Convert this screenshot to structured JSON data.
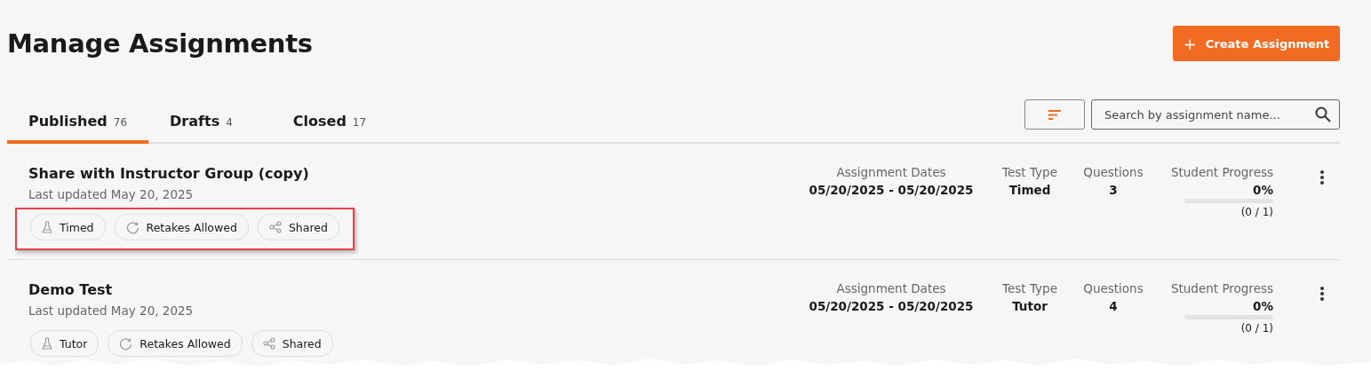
{
  "title": "Manage Assignments",
  "create_button": {
    "label": "Create Assignment",
    "icon": "+"
  },
  "tabs": [
    {
      "label": "Published",
      "count": "76",
      "selected": true
    },
    {
      "label": "Drafts",
      "count": "4",
      "selected": false
    },
    {
      "label": "Closed",
      "count": "17",
      "selected": false
    }
  ],
  "search": {
    "placeholder": "Search by assignment name..."
  },
  "assignments": [
    {
      "name": "Share with Instructor Group (copy)",
      "updated": "Last updated May 20, 2025",
      "highlighted": true,
      "tags": [
        {
          "kind": "flask",
          "label": "Timed"
        },
        {
          "kind": "retake",
          "label": "Retakes Allowed"
        },
        {
          "kind": "share",
          "label": "Shared"
        }
      ],
      "dates_label": "Assignment Dates",
      "dates": "05/20/2025 - 05/20/2025",
      "type_label": "Test Type",
      "type": "Timed",
      "questions_label": "Questions",
      "questions": "3",
      "progress_label": "Student Progress",
      "progress_percent": "0%",
      "level": 0,
      "progress_count": "(0 / 1)"
    },
    {
      "name": "Demo Test",
      "updated": "Last updated May 20, 2025",
      "highlighted": false,
      "tags": [
        {
          "kind": "flask",
          "label": "Tutor"
        },
        {
          "kind": "retake",
          "label": "Retakes Allowed"
        },
        {
          "kind": "share",
          "label": "Shared"
        }
      ],
      "dates_label": "Assignment Dates",
      "dates": "05/20/2025 - 05/20/2025",
      "type_label": "Test Type",
      "type": "Tutor",
      "questions_label": "Questions",
      "questions": "4",
      "progress_label": "Student Progress",
      "progress_percent": "0%",
      "level": 0,
      "progress_count": "(0 / 1)"
    }
  ]
}
